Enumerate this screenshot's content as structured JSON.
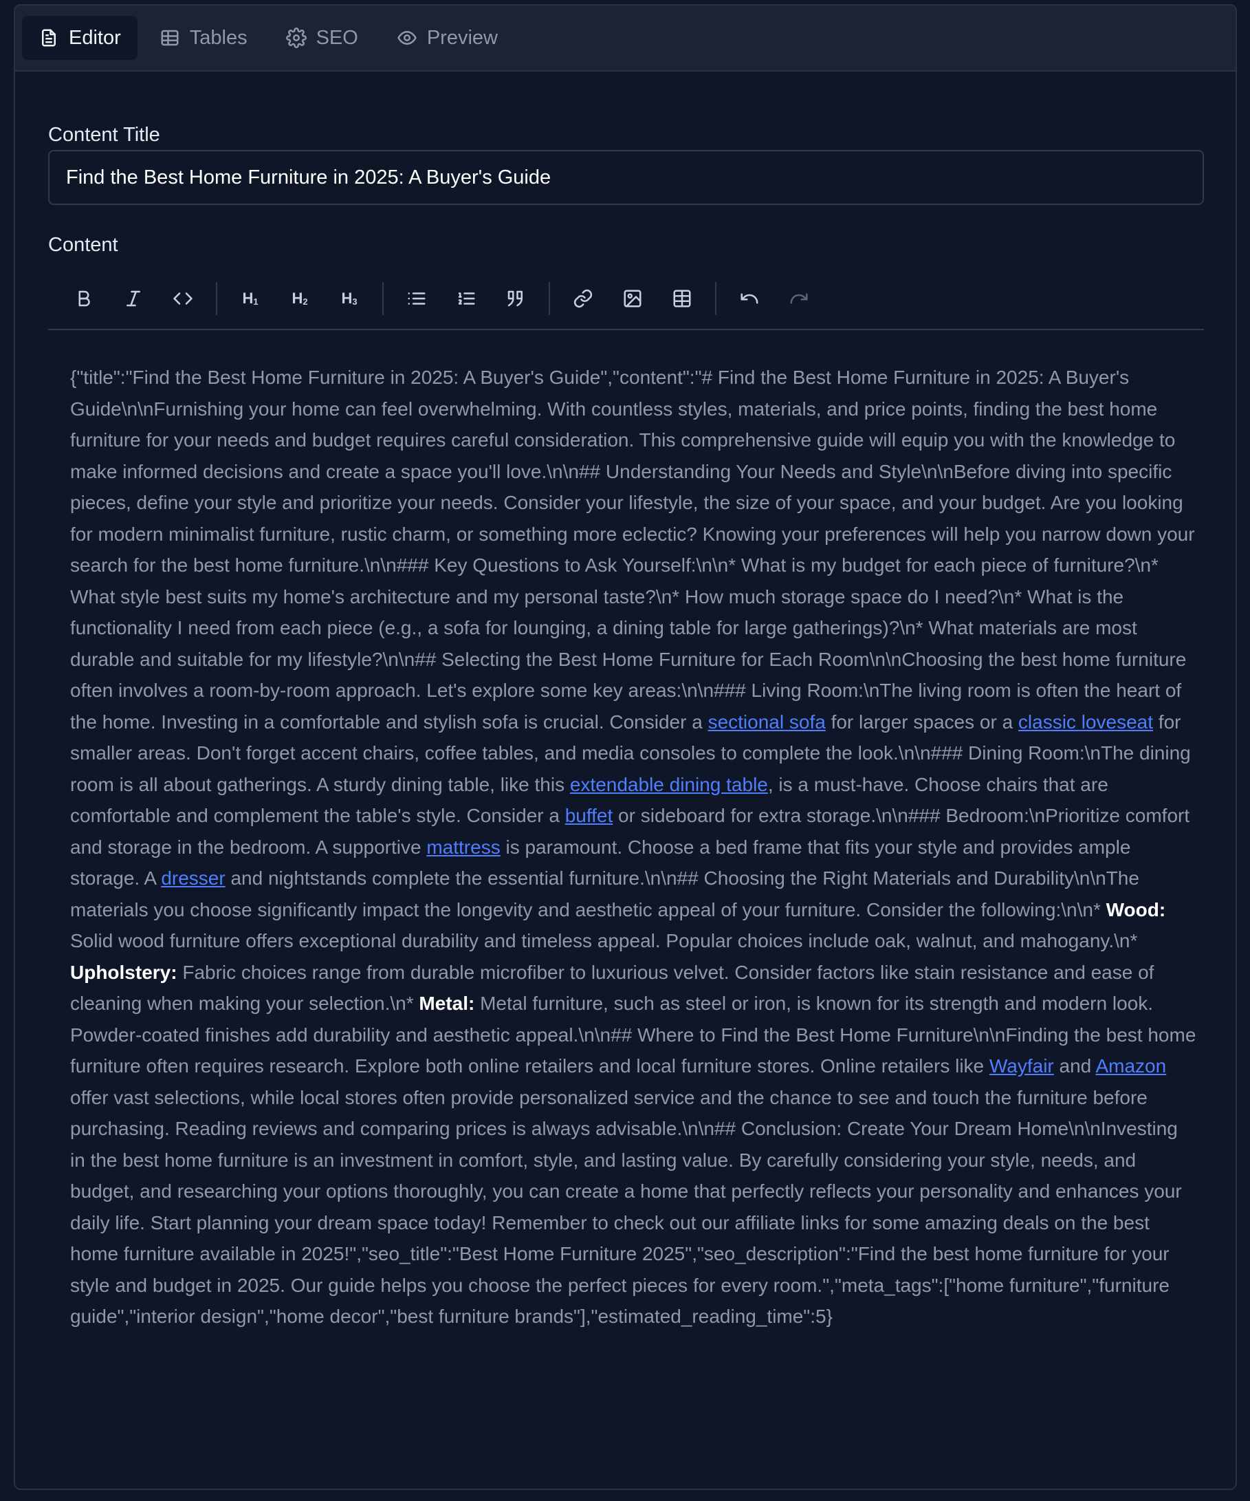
{
  "tabs": [
    {
      "label": "Editor",
      "icon": "file-text-icon",
      "active": true
    },
    {
      "label": "Tables",
      "icon": "table-icon",
      "active": false
    },
    {
      "label": "SEO",
      "icon": "gear-icon",
      "active": false
    },
    {
      "label": "Preview",
      "icon": "eye-icon",
      "active": false
    }
  ],
  "content_title_label": "Content Title",
  "content_title_value": "Find the Best Home Furniture in 2025: A Buyer's Guide",
  "content_label": "Content",
  "toolbar": [
    "bold-icon",
    "italic-icon",
    "code-icon",
    "heading-1-icon",
    "heading-2-icon",
    "heading-3-icon",
    "bullet-list-icon",
    "ordered-list-icon",
    "quote-icon",
    "link-icon",
    "image-icon",
    "table-icon",
    "undo-icon",
    "redo-icon"
  ],
  "body": {
    "p1": "{\"title\":\"Find the Best Home Furniture in 2025: A Buyer's Guide\",\"content\":\"# Find the Best Home Furniture in 2025: A Buyer's Guide\\n\\nFurnishing your home can feel overwhelming. With countless styles, materials, and price points, finding the best home furniture for your needs and budget requires careful consideration. This comprehensive guide will equip you with the knowledge to make informed decisions and create a space you'll love.\\n\\n## Understanding Your Needs and Style\\n\\nBefore diving into specific pieces, define your style and prioritize your needs. Consider your lifestyle, the size of your space, and your budget. Are you looking for modern minimalist furniture, rustic charm, or something more eclectic? Knowing your preferences will help you narrow down your search for the best home furniture.\\n\\n### Key Questions to Ask Yourself:\\n\\n* What is my budget for each piece of furniture?\\n* What style best suits my home's architecture and my personal taste?\\n* How much storage space do I need?\\n* What is the functionality I need from each piece (e.g., a sofa for lounging, a dining table for large gatherings)?\\n* What materials are most durable and suitable for my lifestyle?\\n\\n## Selecting the Best Home Furniture for Each Room\\n\\nChoosing the best home furniture often involves a room-by-room approach. Let's explore some key areas:\\n\\n### Living Room:\\nThe living room is often the heart of the home. Investing in a comfortable and stylish sofa is crucial. Consider a ",
    "l1": "sectional sofa",
    "p2": " for larger spaces or a ",
    "l2": "classic loveseat",
    "p3": " for smaller areas. Don't forget accent chairs, coffee tables, and media consoles to complete the look.\\n\\n### Dining Room:\\nThe dining room is all about gatherings. A sturdy dining table, like this ",
    "l3": "extendable dining table",
    "p4": ", is a must-have. Choose chairs that are comfortable and complement the table's style. Consider a ",
    "l4": "buffet",
    "p5": " or sideboard for extra storage.\\n\\n### Bedroom:\\nPrioritize comfort and storage in the bedroom. A supportive ",
    "l5": "mattress",
    "p6": " is paramount. Choose a bed frame that fits your style and provides ample storage. A ",
    "l6": "dresser",
    "p7": " and nightstands complete the essential furniture.\\n\\n## Choosing the Right Materials and Durability\\n\\nThe materials you choose significantly impact the longevity and aesthetic appeal of your furniture. Consider the following:\\n\\n* ",
    "b1": "Wood:",
    "p8": " Solid wood furniture offers exceptional durability and timeless appeal. Popular choices include oak, walnut, and mahogany.\\n* ",
    "b2": "Upholstery:",
    "p9": " Fabric choices range from durable microfiber to luxurious velvet. Consider factors like stain resistance and ease of cleaning when making your selection.\\n* ",
    "b3": "Metal:",
    "p10": " Metal furniture, such as steel or iron, is known for its strength and modern look. Powder-coated finishes add durability and aesthetic appeal.\\n\\n## Where to Find the Best Home Furniture\\n\\nFinding the best home furniture often requires research. Explore both online retailers and local furniture stores. Online retailers like ",
    "l7": "Wayfair",
    "p11": " and ",
    "l8": "Amazon",
    "p12": " offer vast selections, while local stores often provide personalized service and the chance to see and touch the furniture before purchasing. Reading reviews and comparing prices is always advisable.\\n\\n## Conclusion: Create Your Dream Home\\n\\nInvesting in the best home furniture is an investment in comfort, style, and lasting value. By carefully considering your style, needs, and budget, and researching your options thoroughly, you can create a home that perfectly reflects your personality and enhances your daily life. Start planning your dream space today! Remember to check out our affiliate links for some amazing deals on the best home furniture available in 2025!\",\"seo_title\":\"Best Home Furniture 2025\",\"seo_description\":\"Find the best home furniture for your style and budget in 2025. Our guide helps you choose the perfect pieces for every room.\",\"meta_tags\":[\"home furniture\",\"furniture guide\",\"interior design\",\"home decor\",\"best furniture brands\"],\"estimated_reading_time\":5}"
  },
  "colors": {
    "background": "#0f1628",
    "tabbar": "#1b2334",
    "link": "#4f7fff",
    "text_muted": "#8f99aa"
  }
}
